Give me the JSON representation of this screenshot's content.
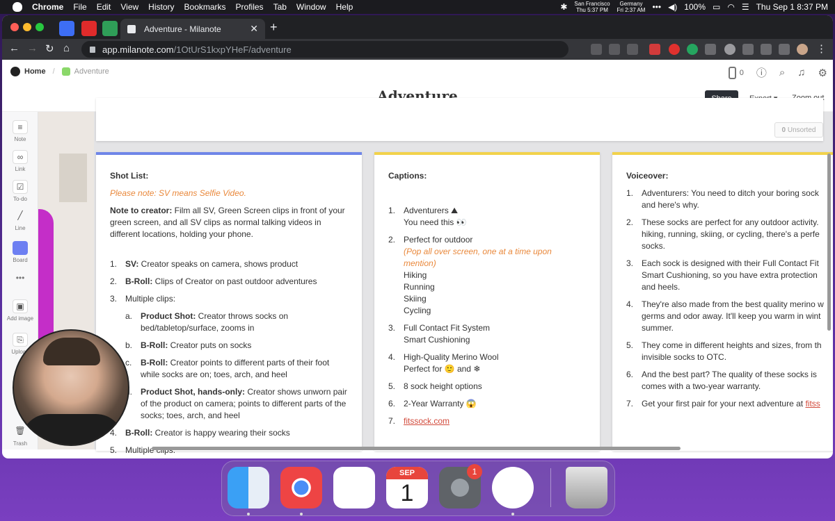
{
  "menubar": {
    "app": "Chrome",
    "items": [
      "File",
      "Edit",
      "View",
      "History",
      "Bookmarks",
      "Profiles",
      "Tab",
      "Window",
      "Help"
    ],
    "clock1_city": "San Francisco",
    "clock1_time": "Thu 5:37 PM",
    "clock2_city": "Germany",
    "clock2_time": "Fri 2:37 AM",
    "battery": "100%",
    "datetime": "Thu Sep 1  8:37 PM"
  },
  "browser": {
    "tab_title": "Adventure - Milanote",
    "url_host": "app.milanote.com",
    "url_path": "/1OtUrS1kxpYHeF/adventure"
  },
  "header": {
    "home": "Home",
    "board_crumb": "Adventure",
    "title": "Adventure",
    "phone_count": "0",
    "share": "Share",
    "export": "Export ▾",
    "zoom": "Zoom out"
  },
  "tools": [
    "Note",
    "Link",
    "To-do",
    "Line",
    "Board",
    "Add image",
    "Upload",
    "Trash"
  ],
  "unsorted": {
    "count": "0",
    "label": "Unsorted"
  },
  "shotlist": {
    "title": "Shot List:",
    "note": "Please note: SV means Selfie Video.",
    "creator_prefix": "Note to creator:",
    "creator_text": " Film all SV, Green Screen clips in front of your green screen, and all SV clips as normal talking videos in different locations, holding your phone.",
    "items": [
      {
        "n": "1.",
        "b": "SV:",
        "t": " Creator speaks on camera, shows product"
      },
      {
        "n": "2.",
        "b": "B-Roll:",
        "t": " Clips of Creator on past outdoor adventures"
      },
      {
        "n": "3.",
        "b": "",
        "t": "Multiple clips:"
      }
    ],
    "sub": [
      {
        "n": "a.",
        "b": "Product Shot:",
        "t": " Creator throws socks on bed/tabletop/surface, zooms in"
      },
      {
        "n": "b.",
        "b": "B-Roll:",
        "t": " Creator puts on socks"
      },
      {
        "n": "c.",
        "b": "B-Roll:",
        "t": " Creator points to different parts of their foot while socks are on; toes, arch, and heel"
      },
      {
        "n": "d.",
        "b": "Product Shot, hands-only:",
        "t": " Creator shows unworn pair of the product on camera; points to different parts of the socks; toes, arch, and heel"
      }
    ],
    "item4": {
      "n": "4.",
      "b": "B-Roll:",
      "t": " Creator is happy wearing their socks"
    },
    "item5": {
      "n": "5.",
      "t": "Multiple clips:"
    }
  },
  "captions": {
    "title": "Captions:",
    "items": [
      {
        "n": "1.",
        "lines": [
          "Adventurers ⛰",
          "You need this 👀"
        ]
      },
      {
        "n": "2.",
        "lines": [
          "Perfect for outdoor"
        ],
        "note": "(Pop all over screen, one at a time upon mention)",
        "more": [
          "Hiking",
          "Running",
          "Skiing",
          "Cycling"
        ]
      },
      {
        "n": "3.",
        "lines": [
          "Full Contact Fit System",
          "Smart Cushioning"
        ]
      },
      {
        "n": "4.",
        "lines": [
          "High-Quality Merino Wool",
          "Perfect for 🙂 and ❄"
        ]
      },
      {
        "n": "5.",
        "lines": [
          "8 sock height options"
        ]
      },
      {
        "n": "6.",
        "lines": [
          "2-Year Warranty 😱"
        ]
      }
    ],
    "link_n": "7.",
    "link": "fitssock.com"
  },
  "voiceover": {
    "title": "Voiceover:",
    "items": [
      {
        "n": "1.",
        "t": "Adventurers: You need to ditch your boring sock and here's why."
      },
      {
        "n": "2.",
        "t": "These socks are perfect for any outdoor activity. hiking, running, skiing, or cycling, there's a perfe socks."
      },
      {
        "n": "3.",
        "t": "Each sock is designed with their Full Contact Fit Smart Cushioning, so you have extra protection and heels."
      },
      {
        "n": "4.",
        "t": "They're also made from the best quality merino w germs and odor away. It'll keep you warm in wint summer."
      },
      {
        "n": "5.",
        "t": "They come in different heights and sizes, from th invisible socks to OTC."
      },
      {
        "n": "6.",
        "t": "And the best part? The quality of these socks is comes with a two-year warranty."
      }
    ],
    "last_n": "7.",
    "last_text": "Get your first pair for your next adventure at ",
    "last_link": "fitss"
  },
  "dock": {
    "calendar_month": "SEP",
    "calendar_day": "1",
    "settings_badge": "1"
  }
}
